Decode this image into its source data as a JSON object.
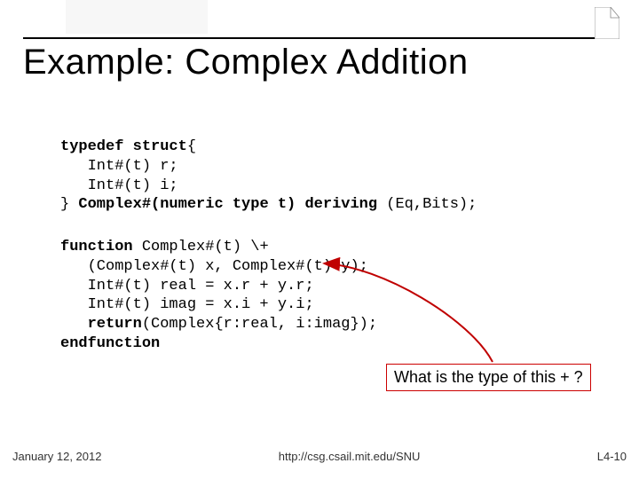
{
  "title": "Example: Complex Addition",
  "code1": {
    "l1a": "typedef struct",
    "l1b": "{",
    "l2": "   Int#(t) r;",
    "l3": "   Int#(t) i;",
    "l4a": "} ",
    "l4b": "Complex",
    "l4c": "#(numeric type t) deriving ",
    "l4d": "(Eq,Bits);"
  },
  "code2": {
    "l1a": "function",
    "l1b": " Complex#(t) \\+",
    "l2": "   (Complex#(t) x, Complex#(t) y);",
    "l3": "   Int#(t) real = x.r + y.r;",
    "l4": "   Int#(t) imag = x.i + y.i;",
    "l5a": "   ",
    "l5b": "return",
    "l5c": "(Complex{r:real, i:imag});",
    "l6": "endfunction"
  },
  "callout": "What is the type of this + ?",
  "footer": {
    "date": "January 12, 2012",
    "url": "http://csg.csail.mit.edu/SNU",
    "page": "L4-10"
  }
}
